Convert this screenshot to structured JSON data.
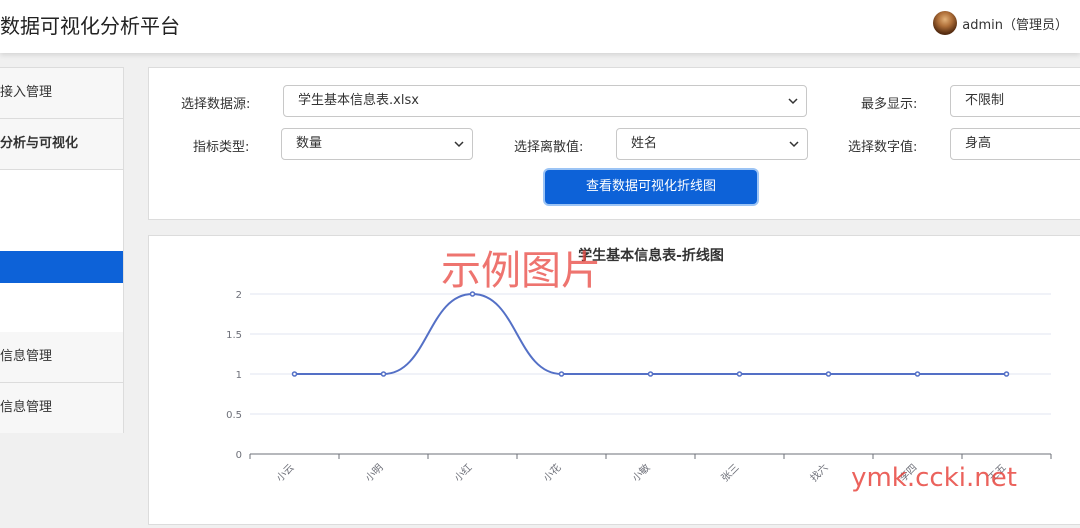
{
  "header": {
    "title": "数据可视化分析平台",
    "user": "admin（管理员）"
  },
  "sidebar": {
    "items": [
      {
        "label": "接入管理"
      },
      {
        "label": "分析与可视化"
      },
      {
        "label": "信息管理"
      },
      {
        "label": "信息管理"
      }
    ]
  },
  "form": {
    "datasource_label": "选择数据源:",
    "datasource_value": "学生基本信息表.xlsx",
    "max_label": "最多显示:",
    "max_value": "不限制",
    "indicator_label": "指标类型:",
    "indicator_value": "数量",
    "discrete_label": "选择离散值:",
    "discrete_value": "姓名",
    "numeric_label": "选择数字值:",
    "numeric_value": "身高",
    "submit_label": "查看数据可视化折线图"
  },
  "watermarks": {
    "sample": "示例图片",
    "site": "ymk.ccki.net"
  },
  "colors": {
    "primary": "#0d62d8",
    "line": "#5470c6"
  },
  "chart_data": {
    "type": "line",
    "title": "学生基本信息表-折线图",
    "categories": [
      "小云",
      "小明",
      "小红",
      "小花",
      "小敏",
      "张三",
      "找六",
      "李四",
      "王五"
    ],
    "values": [
      1,
      1,
      2,
      1,
      1,
      1,
      1,
      1,
      1
    ],
    "ylim": [
      0,
      2
    ],
    "yticks": [
      0,
      0.5,
      1,
      1.5,
      2
    ],
    "smooth": true,
    "grid": true
  }
}
